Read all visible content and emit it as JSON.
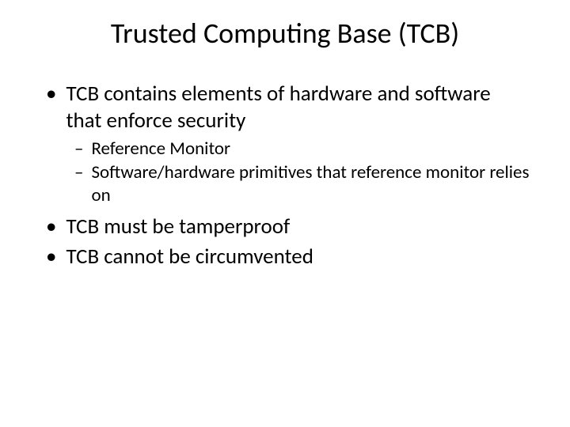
{
  "title": "Trusted Computing Base (TCB)",
  "bullets": {
    "item1": "TCB contains elements of hardware and software that enforce security",
    "sub1": "Reference Monitor",
    "sub2": "Software/hardware primitives that reference monitor relies on",
    "item2": "TCB must be tamperproof",
    "item3": "TCB cannot be circumvented"
  },
  "markers": {
    "bullet": "•",
    "dash": "–"
  }
}
